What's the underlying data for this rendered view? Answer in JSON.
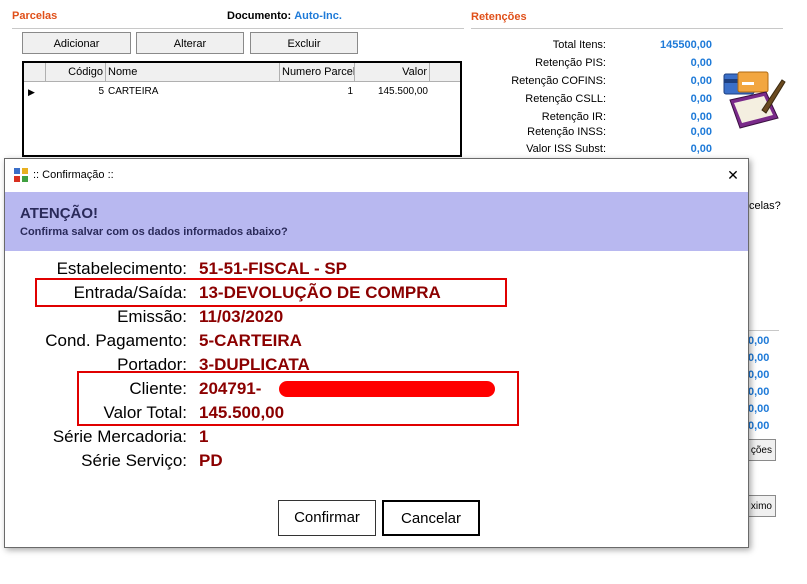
{
  "parcelas": {
    "title": "Parcelas",
    "documento_label": "Documento:",
    "documento_value": "Auto-Inc.",
    "buttons": {
      "adicionar": "Adicionar",
      "alterar": "Alterar",
      "excluir": "Excluir"
    },
    "columns": [
      "Código",
      "Nome",
      "Numero Parcel",
      "Valor"
    ],
    "rows": [
      {
        "codigo": "5",
        "nome": "CARTEIRA",
        "numero": "1",
        "valor": "145.500,00",
        "marker": "▶"
      }
    ]
  },
  "retencoes": {
    "title": "Retenções",
    "items": [
      {
        "label": "Total Itens:",
        "value": "145500,00"
      },
      {
        "label": "Retenção PIS:",
        "value": "0,00"
      },
      {
        "label": "Retenção COFINS:",
        "value": "0,00"
      },
      {
        "label": "Retenção CSLL:",
        "value": "0,00"
      },
      {
        "label": "Retenção IR:",
        "value": "0,00"
      },
      {
        "label": "Retenção INSS:",
        "value": "0,00"
      },
      {
        "label": "Valor ISS Subst:",
        "value": "0,00"
      }
    ]
  },
  "background_partial": {
    "parcelas_q": "celas?",
    "values": [
      "0,00",
      "0,00",
      "0,00",
      "0,00",
      "0,00",
      "0,00"
    ],
    "btn1": "ções",
    "btn2": "ximo"
  },
  "dialog": {
    "title": ":: Confirmação ::",
    "close": "✕",
    "heading": "ATENÇÃO!",
    "subheading": "Confirma salvar com os dados informados abaixo?",
    "fields": [
      {
        "label": "Estabelecimento:",
        "value": "51-51-FISCAL - SP"
      },
      {
        "label": "Entrada/Saída:",
        "value": "13-DEVOLUÇÃO DE COMPRA"
      },
      {
        "label": "Emissão:",
        "value": "11/03/2020"
      },
      {
        "label": "Cond. Pagamento:",
        "value": "5-CARTEIRA"
      },
      {
        "label": "Portador:",
        "value": "3-DUPLICATA"
      },
      {
        "label": "Cliente:",
        "value": "204791-"
      },
      {
        "label": "Valor Total:",
        "value": "145.500,00"
      },
      {
        "label": "Série Mercadoria:",
        "value": "1"
      },
      {
        "label": "Série Serviço:",
        "value": "PD"
      }
    ],
    "confirm": "Confirmar",
    "cancel": "Cancelar"
  }
}
